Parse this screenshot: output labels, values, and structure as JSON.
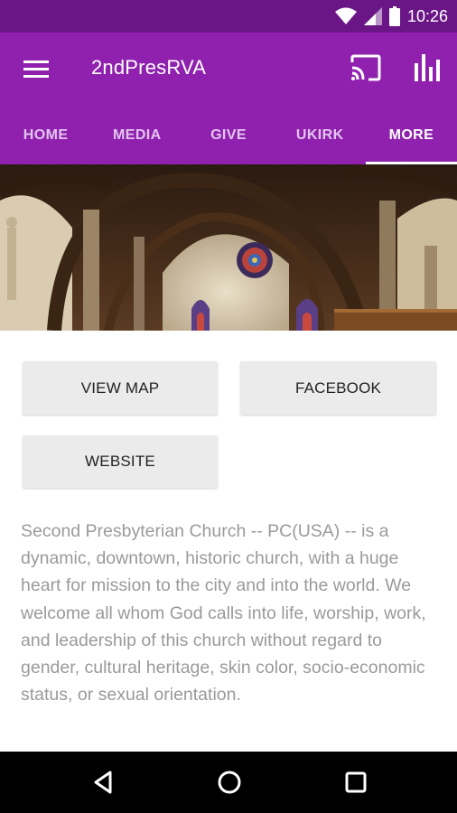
{
  "status_bar": {
    "time": "10:26",
    "icons": [
      "wifi-icon",
      "signal-icon",
      "battery-icon"
    ]
  },
  "app_bar": {
    "title": "2ndPresRVA",
    "icons": [
      "menu-icon",
      "cast-icon",
      "bar-chart-icon"
    ]
  },
  "tabs": [
    {
      "label": "HOME",
      "active": false
    },
    {
      "label": "MEDIA",
      "active": false
    },
    {
      "label": "GIVE",
      "active": false
    },
    {
      "label": "UKIRK",
      "active": false
    },
    {
      "label": "MORE",
      "active": true
    }
  ],
  "buttons": {
    "view_map": "VIEW MAP",
    "facebook": "FACEBOOK",
    "website": "WEBSITE"
  },
  "description": "Second Presbyterian Church -- PC(USA) -- is a dynamic, downtown, historic church, with a huge heart for mission to the city and into the world. We welcome all whom God calls into life, worship, work, and leadership of this church without regard to gender, cultural heritage, skin color, socio-economic status, or sexual orientation.",
  "nav": [
    "back-icon",
    "home-circle-icon",
    "recents-square-icon"
  ],
  "colors": {
    "status_bar": "#6b1687",
    "app_bar": "#8f21ae",
    "button_bg": "#ebebeb",
    "text_gray": "#9a9a9a"
  }
}
